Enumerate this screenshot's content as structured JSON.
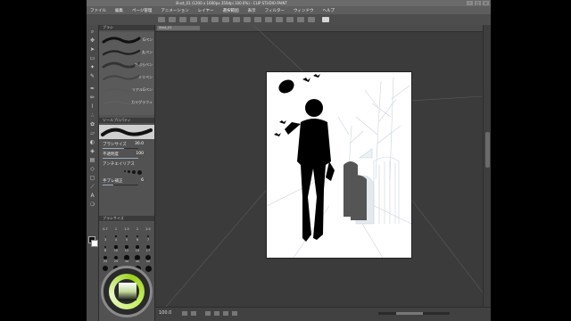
{
  "window": {
    "title": "illust_01 (1200 x 1600px 350dpi 100.0%) - CLIP STUDIO PAINT",
    "controls": [
      "–",
      "□",
      "×"
    ]
  },
  "menubar": [
    "ファイル",
    "編集",
    "ページ管理",
    "アニメーション",
    "レイヤー",
    "選択範囲",
    "表示",
    "フィルター",
    "ウィンドウ",
    "ヘルプ"
  ],
  "canvas_tab": {
    "label": "illust_01"
  },
  "brush_panel": {
    "header": "ブラシ",
    "items": [
      {
        "label": "Gペン"
      },
      {
        "label": "丸ペン"
      },
      {
        "label": "かぶらペン"
      },
      {
        "label": "ミリペン"
      },
      {
        "label": "リアルGペン"
      },
      {
        "label": "カリグラフィ"
      }
    ]
  },
  "tool_property": {
    "header": "ツールプロパティ",
    "brush_size_label": "ブラシサイズ",
    "brush_size_value": "30.0",
    "opacity_label": "不透明度",
    "opacity_value": "100",
    "antialias_label": "アンチエイリアス",
    "stabilization_label": "手ブレ補正",
    "stabilization_value": "6",
    "brush_size_fraction": 0.6,
    "opacity_fraction": 1.0,
    "stabilization_fraction": 0.3
  },
  "brush_size_panel": {
    "header": "ブラシサイズ",
    "sizes": [
      "0.7",
      "1",
      "1.5",
      "2",
      "2.5",
      "3",
      "4",
      "5",
      "6",
      "7",
      "8",
      "10",
      "12",
      "15",
      "17",
      "20",
      "25",
      "30",
      "40",
      "50"
    ]
  },
  "statusbar": {
    "zoom": "100.0"
  },
  "colors": {
    "accent": "#9bd21a",
    "panel": "#525252",
    "canvas_bg": "#3b3b3b"
  }
}
